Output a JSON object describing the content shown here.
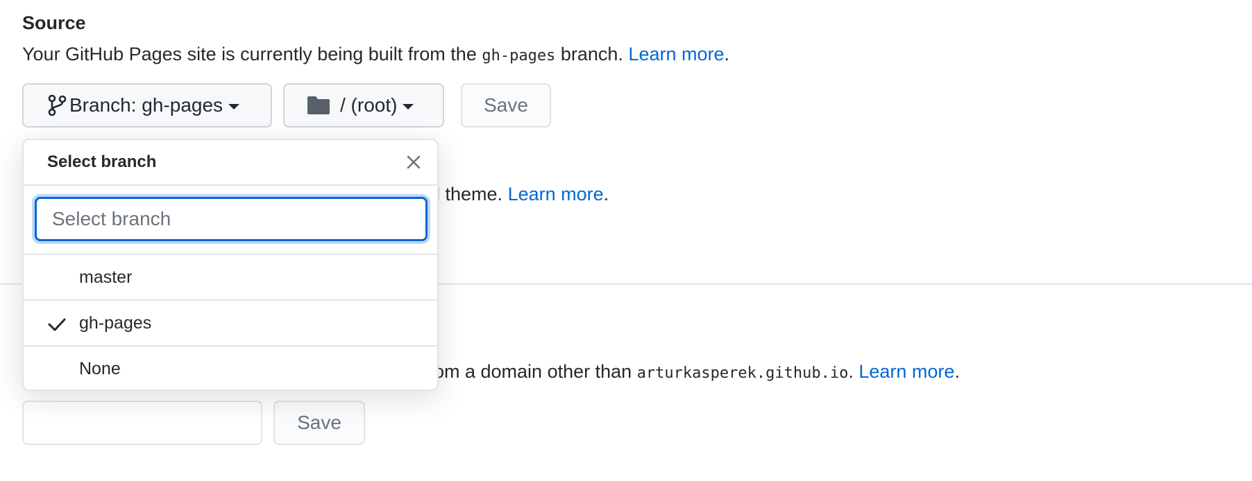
{
  "source": {
    "heading": "Source",
    "desc_prefix": "Your GitHub Pages site is currently being built from the",
    "branch_code": "gh-pages",
    "desc_suffix": "branch.",
    "learn_more": "Learn more",
    "period": "."
  },
  "branch_button": {
    "label": "Branch: gh-pages"
  },
  "folder_button": {
    "label": "/ (root)"
  },
  "save_label": "Save",
  "theme_line": {
    "fragment": "ll theme.",
    "learn_more": "Learn more",
    "period": "."
  },
  "domain_line": {
    "fragment": "rom a domain other than",
    "domain_code": "arturkasperek.github.io",
    "period_after_code": ".",
    "learn_more": "Learn more",
    "period": "."
  },
  "custom_domain": {
    "value": "",
    "save_label": "Save"
  },
  "popover": {
    "title": "Select branch",
    "search_placeholder": "Select branch",
    "items": [
      {
        "label": "master",
        "selected": false
      },
      {
        "label": "gh-pages",
        "selected": true
      },
      {
        "label": "None",
        "selected": false
      }
    ]
  },
  "colors": {
    "link": "#0366d6",
    "focus": "#0366d6",
    "border": "#e1e4e8"
  },
  "icons": {
    "branch": "git-branch-icon",
    "folder": "folder-icon",
    "close": "close-icon",
    "check": "check-icon"
  }
}
